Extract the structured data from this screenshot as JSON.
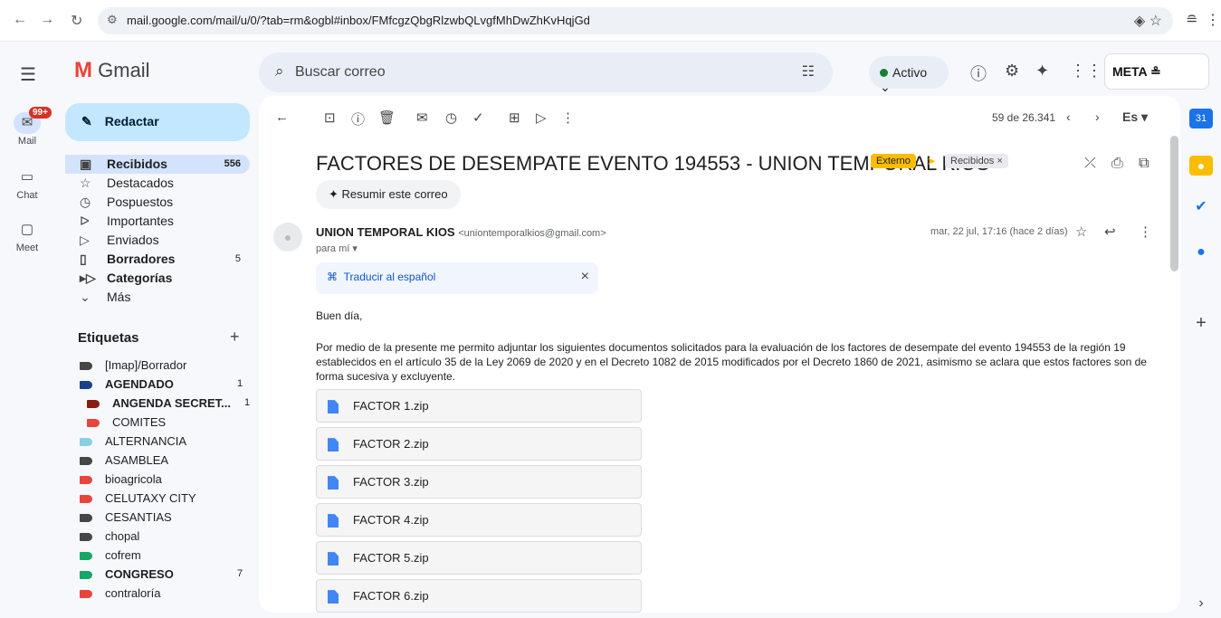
{
  "browser": {
    "url": "mail.google.com/mail/u/0/?tab=rm&ogbl#inbox/FMfcgzQbgRlzwbQLvgfMhDwZhKvHqjGd"
  },
  "app": {
    "name": "Gmail"
  },
  "rail": {
    "mail_label": "Mail",
    "mail_badge": "99+",
    "chat_label": "Chat",
    "meet_label": "Meet"
  },
  "search": {
    "placeholder": "Buscar correo"
  },
  "status": {
    "label": "Activo"
  },
  "org_logo_text": "META",
  "compose": {
    "label": "Redactar"
  },
  "nav": [
    {
      "label": "Recibidos",
      "count": "556"
    },
    {
      "label": "Destacados",
      "count": ""
    },
    {
      "label": "Pospuestos",
      "count": ""
    },
    {
      "label": "Importantes",
      "count": ""
    },
    {
      "label": "Enviados",
      "count": ""
    },
    {
      "label": "Borradores",
      "count": "5"
    },
    {
      "label": "Categorías",
      "count": ""
    },
    {
      "label": "Más",
      "count": ""
    }
  ],
  "labels_title": "Etiquetas",
  "labels": [
    {
      "name": "[Imap]/Borrador",
      "count": "",
      "color": "#444746"
    },
    {
      "name": "AGENDADO",
      "count": "1",
      "color": "#1a3f8b"
    },
    {
      "name": "ANGENDA SECRET...",
      "count": "1",
      "color": "#8a1c14"
    },
    {
      "name": "COMITES",
      "count": "",
      "color": "#e8453c"
    },
    {
      "name": "ALTERNANCIA",
      "count": "",
      "color": "#89d0e4"
    },
    {
      "name": "ASAMBLEA",
      "count": "",
      "color": "#444746"
    },
    {
      "name": "bioagricola",
      "count": "",
      "color": "#e8453c"
    },
    {
      "name": "CELUTAXY CITY",
      "count": "",
      "color": "#e8453c"
    },
    {
      "name": "CESANTIAS",
      "count": "",
      "color": "#444746"
    },
    {
      "name": "chopal",
      "count": "",
      "color": "#444746"
    },
    {
      "name": "cofrem",
      "count": "",
      "color": "#16a765"
    },
    {
      "name": "CONGRESO",
      "count": "7",
      "color": "#16a765"
    },
    {
      "name": "contraloría",
      "count": "",
      "color": "#e8453c"
    }
  ],
  "pager": {
    "text": "59 de 26.341"
  },
  "language": "Es",
  "email": {
    "subject": "FACTORES DE DESEMPATE EVENTO 194553 - UNION TEMPORAL KIOS",
    "tag_external": "Externo",
    "tag_inbox": "Recibidos ×",
    "summarize": "Resumir este correo",
    "sender_name": "UNION TEMPORAL KIOS",
    "sender_email": "<uniontemporalkios@gmail.com>",
    "to": "para mí ▾",
    "date": "mar, 22 jul, 17:16 (hace 2 días)",
    "translate": "Traducir al español",
    "greeting": "Buen día,",
    "body": "Por medio de la presente me permito adjuntar los siguientes documentos solicitados para la evaluación de los factores de desempate del evento 194553 de la región 19 establecidos en el artículo 35 de la Ley 2069 de 2020 y en el Decreto 1082 de 2015 modificados por el Decreto 1860 de 2021, asimismo se aclara que estos factores son de forma sucesiva y excluyente.",
    "attachments": [
      "FACTOR 1.zip",
      "FACTOR 2.zip",
      "FACTOR 3.zip",
      "FACTOR 4.zip",
      "FACTOR 5.zip",
      "FACTOR 6.zip"
    ]
  }
}
